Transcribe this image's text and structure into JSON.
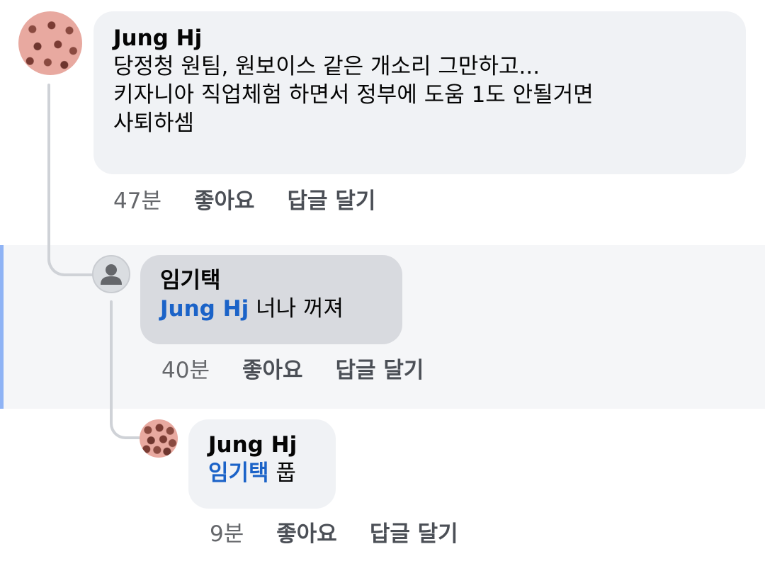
{
  "comments": [
    {
      "author": "Jung Hj",
      "lines": [
        "당정청 원팀, 원보이스 같은 개소리 그만하고...",
        "키자니아 직업체험 하면서 정부에 도움 1도 안될거면",
        "사퇴하셈"
      ],
      "time": "47분",
      "like_label": "좋아요",
      "reply_label": "답글 달기"
    },
    {
      "author": "임기택",
      "mention": "Jung Hj",
      "text": " 너나 꺼져",
      "time": "40분",
      "like_label": "좋아요",
      "reply_label": "답글 달기"
    },
    {
      "author": "Jung Hj",
      "mention": "임기택",
      "text": " 풉",
      "time": "9분",
      "like_label": "좋아요",
      "reply_label": "답글 달기"
    }
  ],
  "colors": {
    "mention": "#1b63c8",
    "highlight_bar": "#8fb3f5",
    "highlight_bg": "#f5f6f8",
    "bubble_light": "#f0f2f5",
    "bubble_dark": "#d8dadf",
    "meta_text": "#65676b"
  },
  "icons": {
    "avatar_photo": "avatar-photo-icon",
    "default_avatar": "default-user-icon"
  }
}
